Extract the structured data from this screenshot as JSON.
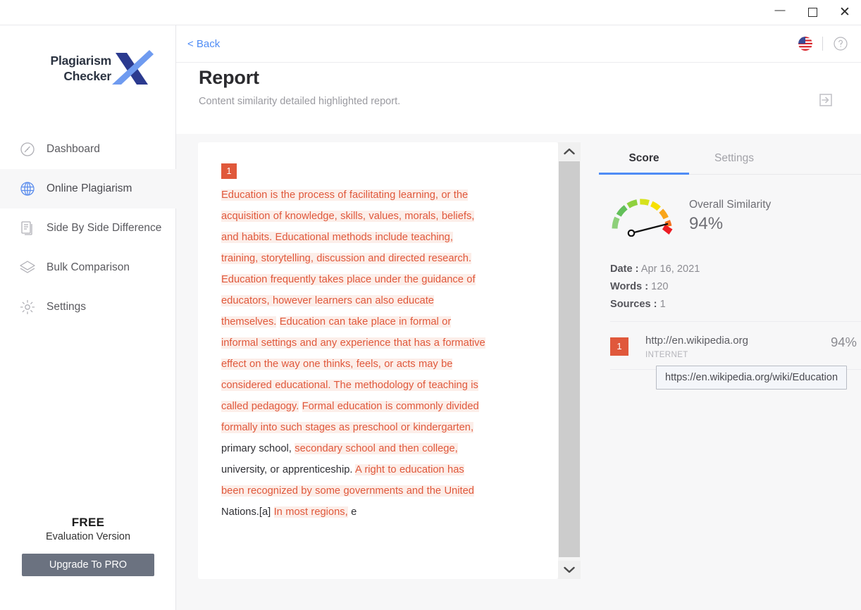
{
  "window": {
    "minimize_label": "—",
    "maximize_label": "",
    "close_label": "✕"
  },
  "sidebar": {
    "logo": {
      "line1": "Plagiarism",
      "line2": "Checker",
      "mark": "X"
    },
    "items": [
      {
        "label": "Dashboard",
        "icon": "gauge-icon",
        "active": false
      },
      {
        "label": "Online Plagiarism",
        "icon": "globe-icon",
        "active": true
      },
      {
        "label": "Side By Side Difference",
        "icon": "document-icon",
        "active": false
      },
      {
        "label": "Bulk Comparison",
        "icon": "layers-icon",
        "active": false
      },
      {
        "label": "Settings",
        "icon": "gear-icon",
        "active": false
      }
    ],
    "upsell": {
      "free_label": "FREE",
      "version_label": "Evaluation Version",
      "button_label": "Upgrade To PRO"
    }
  },
  "topbar": {
    "back_label": "< Back",
    "language_icon": "us-flag-icon",
    "help_icon": "help-circle-icon"
  },
  "page": {
    "title": "Report",
    "subtitle": "Content similarity detailed highlighted report.",
    "export_icon": "export-icon"
  },
  "document": {
    "marker": "1",
    "segments": [
      {
        "text": "Education is the process of facilitating learning, or the acquisition of knowledge, skills, values, morals, beliefs, and habits. Educational methods include teaching, training, storytelling, discussion and directed research. Education frequently takes place under the guidance of educators, however learners can also educate themselves.",
        "highlighted": true
      },
      {
        "text": " ",
        "highlighted": false
      },
      {
        "text": "Education can take place in formal or informal settings and any experience that has a formative effect on the way one thinks, feels, or acts may be considered educational. The methodology of teaching is called pedagogy.",
        "highlighted": true
      },
      {
        "text": " ",
        "highlighted": false
      },
      {
        "text": "Formal education is commonly divided formally into such stages as preschool or kindergarten,",
        "highlighted": true
      },
      {
        "text": " primary school, ",
        "highlighted": false
      },
      {
        "text": "secondary school and then college,",
        "highlighted": true
      },
      {
        "text": " university, or apprenticeship. ",
        "highlighted": false
      },
      {
        "text": "A right to education has been recognized by some governments and the United",
        "highlighted": true
      },
      {
        "text": " Nations.[a] ",
        "highlighted": false
      },
      {
        "text": "In most regions,",
        "highlighted": true
      },
      {
        "text": " e",
        "highlighted": false
      }
    ]
  },
  "scrollbar": {
    "up_arrow": "chevron-up-icon",
    "down_arrow": "chevron-down-icon"
  },
  "score": {
    "tabs": [
      {
        "label": "Score",
        "active": true
      },
      {
        "label": "Settings",
        "active": false
      }
    ],
    "similarity_label": "Overall Similarity",
    "similarity_value": "94%",
    "gauge_percent": 94,
    "meta": [
      {
        "key": "Date :",
        "value": "Apr 16, 2021"
      },
      {
        "key": "Words :",
        "value": "120"
      },
      {
        "key": "Sources :",
        "value": "1"
      }
    ],
    "sources": [
      {
        "index": "1",
        "url": "http://en.wikipedia.org",
        "type": "INTERNET",
        "percent": "94%"
      }
    ],
    "tooltip": "https://en.wikipedia.org/wiki/Education"
  },
  "colors": {
    "accent_blue": "#4f8cf5",
    "highlight_text": "#e0583b",
    "highlight_bg": "#fceee9",
    "badge": "#e0583b",
    "upgrade_button": "#6b7280"
  }
}
